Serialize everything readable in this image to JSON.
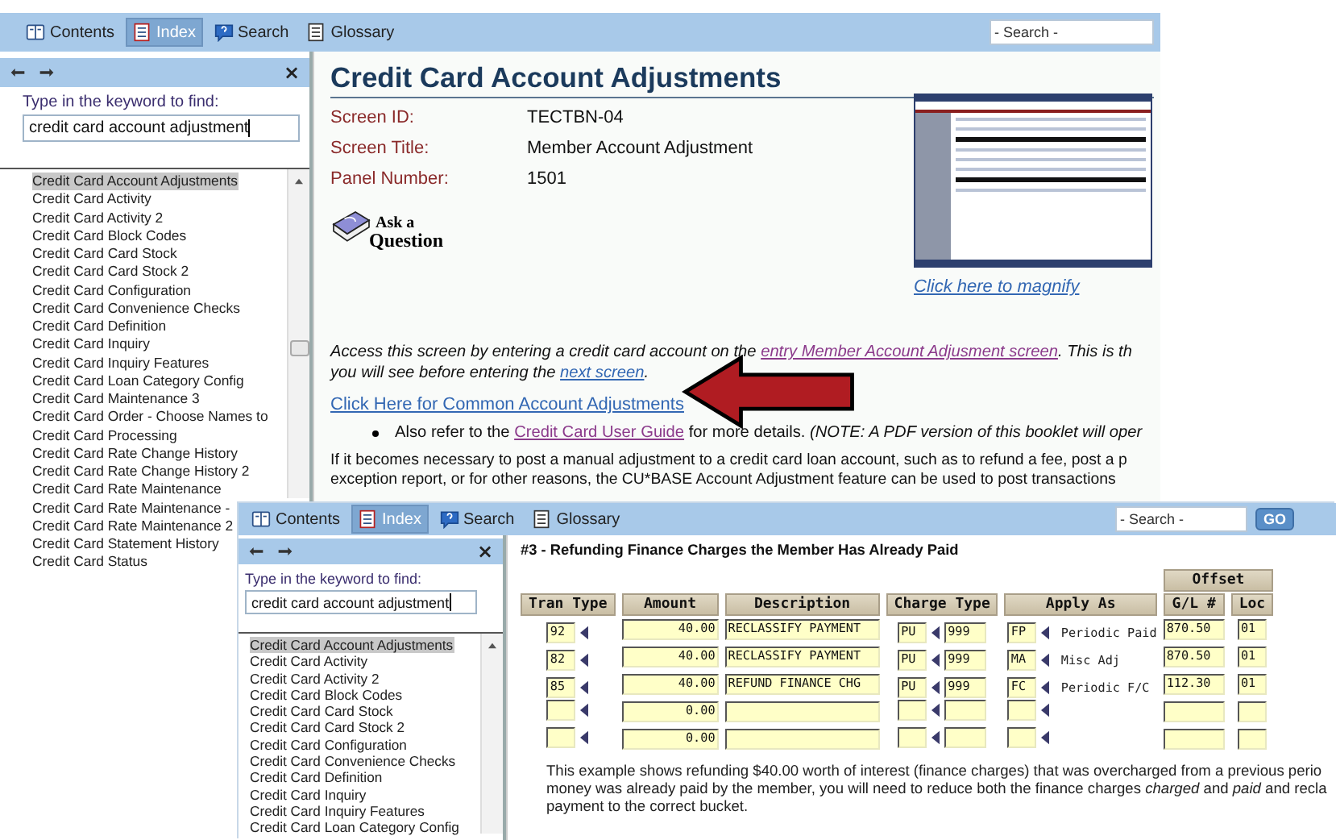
{
  "top_window": {
    "toolbar": {
      "tabs": [
        {
          "label": "Contents",
          "selected": false
        },
        {
          "label": "Index",
          "selected": true
        },
        {
          "label": "Search",
          "selected": false
        },
        {
          "label": "Glossary",
          "selected": false
        }
      ],
      "search": {
        "placeholder": "- Search -"
      }
    },
    "sidebar": {
      "close": "×",
      "prompt": "Type in the keyword to find:",
      "keyword": "credit card account adjustment",
      "items": [
        {
          "label": "Credit Card Account Adjustments",
          "selected": true
        },
        {
          "label": "Credit Card Activity",
          "selected": false
        },
        {
          "label": "Credit Card Activity 2",
          "selected": false
        },
        {
          "label": "Credit Card Block Codes",
          "selected": false
        },
        {
          "label": "Credit Card Card Stock",
          "selected": false
        },
        {
          "label": "Credit Card Card Stock 2",
          "selected": false
        },
        {
          "label": "Credit Card Configuration",
          "selected": false
        },
        {
          "label": "Credit Card Convenience Checks",
          "selected": false
        },
        {
          "label": "Credit Card Definition",
          "selected": false
        },
        {
          "label": "Credit Card Inquiry",
          "selected": false
        },
        {
          "label": "Credit Card Inquiry Features",
          "selected": false
        },
        {
          "label": "Credit Card Loan Category Config",
          "selected": false
        },
        {
          "label": "Credit Card Maintenance 3",
          "selected": false
        },
        {
          "label": "Credit Card Order - Choose Names to",
          "selected": false
        },
        {
          "label": "Credit Card Processing",
          "selected": false
        },
        {
          "label": "Credit Card Rate Change History",
          "selected": false
        },
        {
          "label": "Credit Card Rate Change History 2",
          "selected": false
        },
        {
          "label": "Credit Card Rate Maintenance",
          "selected": false
        },
        {
          "label": "Credit Card Rate Maintenance -",
          "selected": false
        },
        {
          "label": "Credit Card Rate Maintenance 2",
          "selected": false
        },
        {
          "label": "Credit Card Statement History",
          "selected": false
        },
        {
          "label": "Credit Card Status",
          "selected": false
        }
      ]
    },
    "main": {
      "title": "Credit Card Account Adjustments",
      "fields": [
        {
          "label": "Screen ID:",
          "value": "TECTBN-04"
        },
        {
          "label": "Screen Title:",
          "value": "Member Account Adjustment"
        },
        {
          "label": "Panel Number:",
          "value": "1501"
        }
      ],
      "ask_logo": [
        "Ask a",
        "Question"
      ],
      "magnify_link": "Click here to magnify",
      "intro_lines": [
        [
          {
            "kind": "text",
            "text": "Access this screen by entering a credit card account on the "
          },
          {
            "kind": "link",
            "text": "entry Member Account Adjusment screen",
            "visited": true
          },
          {
            "kind": "text",
            "text": ". This is th"
          }
        ],
        [
          {
            "kind": "text",
            "text": "you will see before entering the "
          },
          {
            "kind": "link",
            "text": "next screen",
            "visited": false
          },
          {
            "kind": "text",
            "text": "."
          }
        ]
      ],
      "common_link": "Click Here for Common Account Adjustments",
      "bullet": [
        {
          "kind": "text",
          "text": "Also refer to the "
        },
        {
          "kind": "link",
          "text": "Credit Card User Guide",
          "visited": true
        },
        {
          "kind": "text",
          "text": " for more details. "
        },
        {
          "kind": "italic",
          "text": "(NOTE: A PDF version of this booklet will oper"
        }
      ],
      "paragraph_lines": [
        "If it becomes necessary to post a manual adjustment to a credit card loan account, such as to refund a fee, post a p",
        "exception report, or for other reasons, the CU*BASE Account Adjustment feature can be used to post transactions"
      ]
    }
  },
  "bottom_window": {
    "toolbar": {
      "tabs": [
        {
          "label": "Contents",
          "selected": false
        },
        {
          "label": "Index",
          "selected": true
        },
        {
          "label": "Search",
          "selected": false
        },
        {
          "label": "Glossary",
          "selected": false
        }
      ],
      "search": {
        "placeholder": "- Search -"
      },
      "go_button": "GO"
    },
    "sidebar": {
      "close": "×",
      "prompt": "Type in the keyword to find:",
      "keyword": "credit card account adjustment",
      "items": [
        {
          "label": "Credit Card Account Adjustments",
          "selected": true
        },
        {
          "label": "Credit Card Activity",
          "selected": false
        },
        {
          "label": "Credit Card Activity 2",
          "selected": false
        },
        {
          "label": "Credit Card Block Codes",
          "selected": false
        },
        {
          "label": "Credit Card Card Stock",
          "selected": false
        },
        {
          "label": "Credit Card Card Stock 2",
          "selected": false
        },
        {
          "label": "Credit Card Configuration",
          "selected": false
        },
        {
          "label": "Credit Card Convenience Checks",
          "selected": false
        },
        {
          "label": "Credit Card Definition",
          "selected": false
        },
        {
          "label": "Credit Card Inquiry",
          "selected": false
        },
        {
          "label": "Credit Card Inquiry Features",
          "selected": false
        },
        {
          "label": "Credit Card Loan Category Config",
          "selected": false
        }
      ]
    },
    "main": {
      "title": "#3 - Refunding Finance Charges the Member Has Already Paid",
      "table": {
        "group_header": "Offset",
        "columns": [
          "Tran Type",
          "Amount",
          "Description",
          "Charge Type",
          "Apply As",
          "G/L #",
          "Loc"
        ],
        "rows": [
          {
            "tran_type": "92",
            "amount": "40.00",
            "description": "RECLASSIFY PAYMENT",
            "charge_type": "PU",
            "charge_code": "999",
            "apply_code": "FP",
            "apply_as": "Periodic Paid",
            "gl_account": "870.50",
            "loc": "01"
          },
          {
            "tran_type": "82",
            "amount": "40.00",
            "description": "RECLASSIFY PAYMENT",
            "charge_type": "PU",
            "charge_code": "999",
            "apply_code": "MA",
            "apply_as": "Misc Adj",
            "gl_account": "870.50",
            "loc": "01"
          },
          {
            "tran_type": "85",
            "amount": "40.00",
            "description": "REFUND FINANCE CHG",
            "charge_type": "PU",
            "charge_code": "999",
            "apply_code": "FC",
            "apply_as": "Periodic F/C",
            "gl_account": "112.30",
            "loc": "01"
          },
          {
            "amount": "0.00"
          },
          {
            "amount": "0.00"
          }
        ]
      },
      "paragraph_lines": [
        "This example shows refunding $40.00 worth of interest (finance charges) that was overcharged from a previous perio",
        "money was already paid by the member, you will need to reduce both the finance charges *charged* and *paid* and recla",
        "payment to the correct bucket."
      ]
    }
  }
}
